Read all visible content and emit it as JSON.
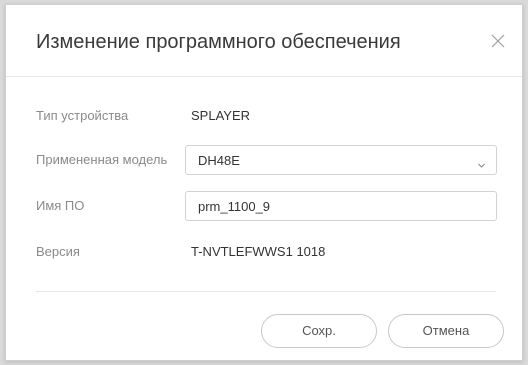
{
  "dialog": {
    "title": "Изменение программного обеспечения",
    "close_icon": "close-icon"
  },
  "form": {
    "device_type": {
      "label": "Тип устройства",
      "value": "SPLAYER"
    },
    "applied_model": {
      "label": "Примененная модель",
      "value": "DH48E",
      "icon": "chevron-down-icon"
    },
    "software_name": {
      "label": "Имя ПО",
      "value": "prm_1100_9"
    },
    "version": {
      "label": "Версия",
      "value": "T-NVTLEFWWS1 1018"
    }
  },
  "buttons": {
    "save_label": "Сохр.",
    "cancel_label": "Отмена"
  }
}
